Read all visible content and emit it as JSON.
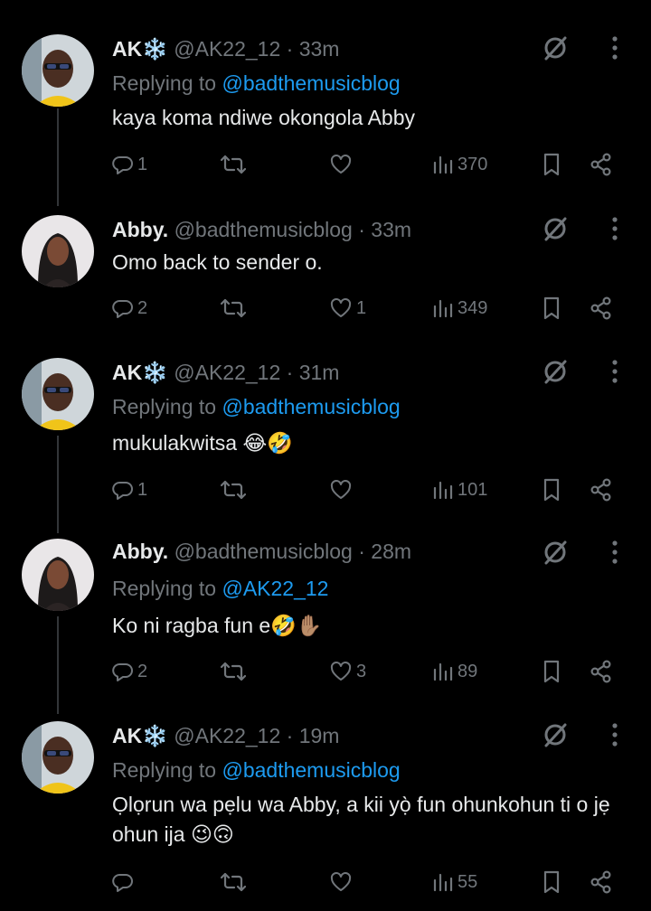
{
  "tweets": [
    {
      "name": "AK❄️",
      "handle": "@AK22_12",
      "dot": "·",
      "time": "33m",
      "reply_prefix": "Replying to",
      "reply_to": "@badthemusicblog",
      "text": "kaya koma ndiwe okongola Abby",
      "replies": "1",
      "retweets": "",
      "likes": "",
      "views": "370"
    },
    {
      "name": "Abby.",
      "handle": "@badthemusicblog",
      "dot": "·",
      "time": "33m",
      "text": "Omo back to sender o.",
      "replies": "2",
      "retweets": "",
      "likes": "1",
      "views": "349"
    },
    {
      "name": "AK❄️",
      "handle": "@AK22_12",
      "dot": "·",
      "time": "31m",
      "reply_prefix": "Replying to",
      "reply_to": "@badthemusicblog",
      "text": "mukulakwitsa 😂🤣",
      "replies": "1",
      "retweets": "",
      "likes": "",
      "views": "101"
    },
    {
      "name": "Abby.",
      "handle": "@badthemusicblog",
      "dot": "·",
      "time": "28m",
      "reply_prefix": "Replying to",
      "reply_to": "@AK22_12",
      "text": "Ko ni ragba fun e🤣✋🏽",
      "replies": "2",
      "retweets": "",
      "likes": "3",
      "views": "89"
    },
    {
      "name": "AK❄️",
      "handle": "@AK22_12",
      "dot": "·",
      "time": "19m",
      "reply_prefix": "Replying to",
      "reply_to": "@badthemusicblog",
      "text": "Ọlọrun wa pẹlu wa Abby, a kii yọ̀ fun ohunkohun ti o jẹ ohun ija 😉🙃",
      "replies": "",
      "retweets": "",
      "likes": "",
      "views": "55"
    }
  ],
  "colors": {
    "background": "#000000",
    "text": "#e7e9ea",
    "muted": "#71767b",
    "link": "#1d9bf0",
    "thread_line": "#333639"
  },
  "icons": [
    "grok-icon",
    "more-icon",
    "reply-icon",
    "retweet-icon",
    "like-icon",
    "views-icon",
    "bookmark-icon",
    "share-icon"
  ]
}
